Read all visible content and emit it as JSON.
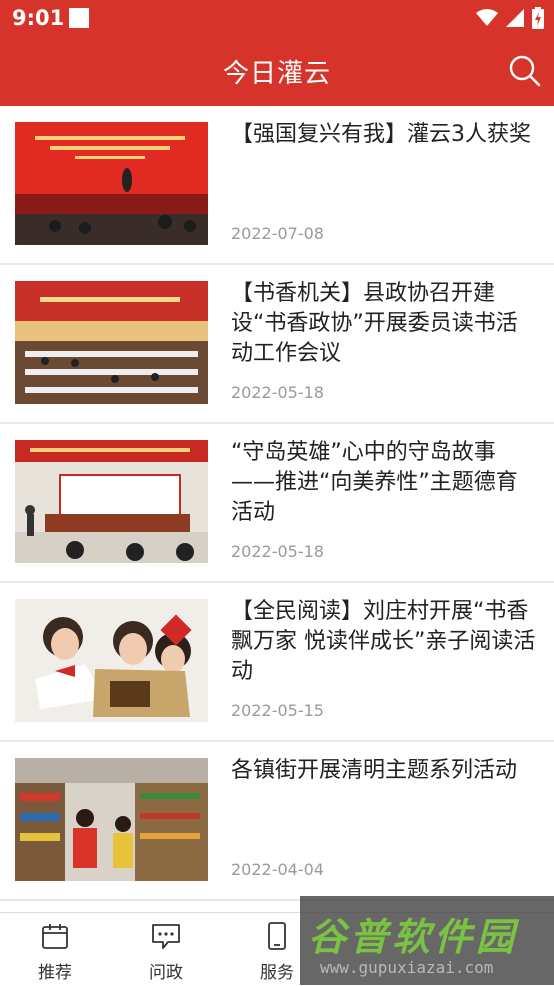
{
  "status_bar": {
    "time": "9:01"
  },
  "header": {
    "title": "今日灌云"
  },
  "news": [
    {
      "title": "【强国复兴有我】灌云3人获奖",
      "date": "2022-07-08"
    },
    {
      "title": "【书香机关】县政协召开建设“书香政协”开展委员读书活动工作会议",
      "date": "2022-05-18"
    },
    {
      "title": "“守岛英雄”心中的守岛故事——推进“向美养性”主题德育活动",
      "date": "2022-05-18"
    },
    {
      "title": "【全民阅读】刘庄村开展“书香飘万家 悦读伴成长”亲子阅读活动",
      "date": "2022-05-15"
    },
    {
      "title": "各镇街开展清明主题系列活动",
      "date": "2022-04-04"
    }
  ],
  "bottom_nav": [
    {
      "label": "推荐"
    },
    {
      "label": "问政"
    },
    {
      "label": "服务"
    }
  ],
  "watermark": {
    "text": "谷普软件园",
    "url": "www.gupuxiazai.com"
  },
  "colors": {
    "brand_red": "#d6342a",
    "date_gray": "#9a9a9a"
  }
}
